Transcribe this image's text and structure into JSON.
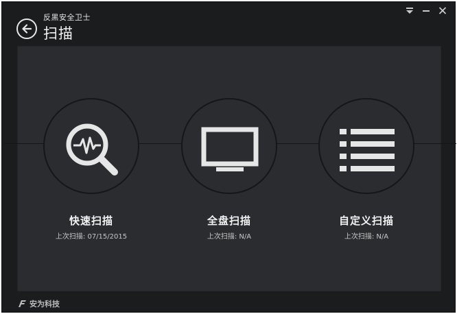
{
  "window": {
    "app_name": "反黑安全卫士",
    "page_title": "扫描"
  },
  "scans": [
    {
      "label": "快速扫描",
      "last_scan_prefix": "上次扫描:",
      "last_scan_value": "07/15/2015",
      "icon": "magnifier-heartbeat-icon"
    },
    {
      "label": "全盘扫描",
      "last_scan_prefix": "上次扫描:",
      "last_scan_value": "N/A",
      "icon": "monitor-icon"
    },
    {
      "label": "自定义扫描",
      "last_scan_prefix": "上次扫描:",
      "last_scan_value": "N/A",
      "icon": "list-icon"
    }
  ],
  "footer": {
    "brand": "安为科技"
  },
  "colors": {
    "background": "#1b1c1e",
    "panel": "#2b2c2f",
    "icon": "#e6e6e6"
  }
}
